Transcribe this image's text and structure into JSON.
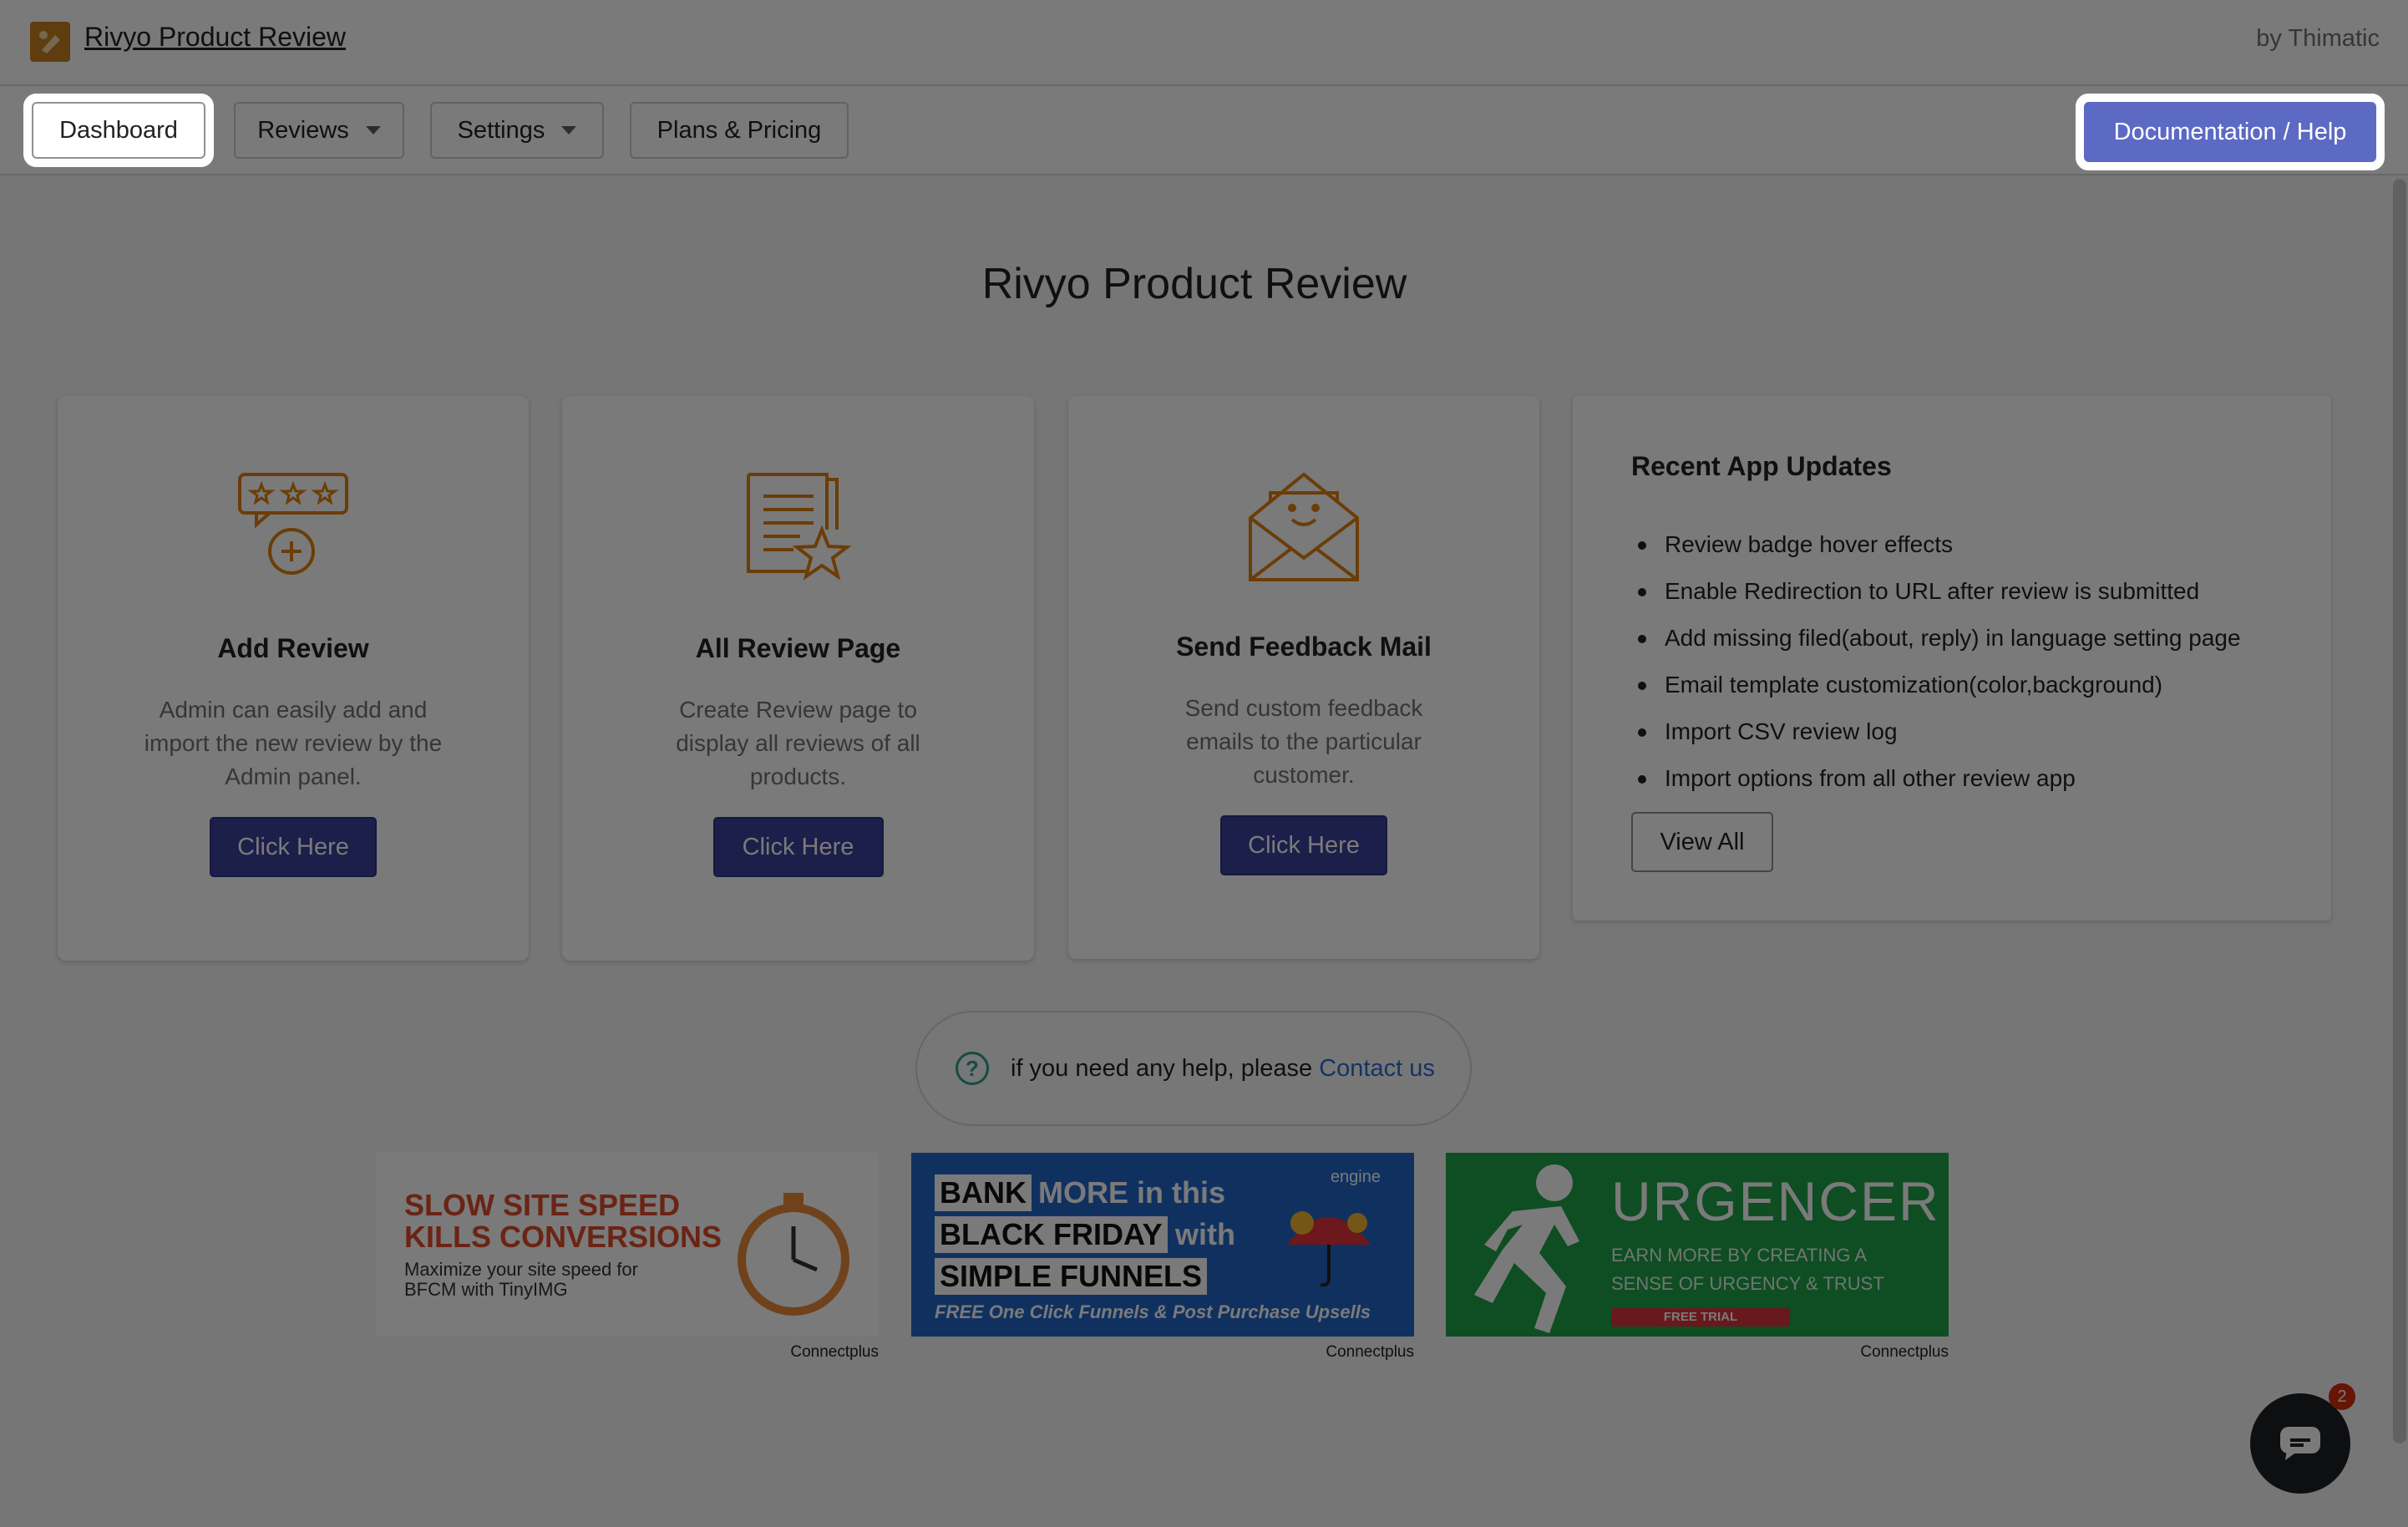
{
  "app": {
    "title": "Rivyo Product Review",
    "by": "by Thimatic",
    "logo_icon": "rivyo-logo-icon"
  },
  "nav": {
    "dashboard": "Dashboard",
    "reviews": "Reviews",
    "settings": "Settings",
    "plans": "Plans & Pricing",
    "docs": "Documentation / Help"
  },
  "main": {
    "heading": "Rivyo Product Review",
    "cards": [
      {
        "title": "Add Review",
        "desc": "Admin can easily add and import the new review by the Admin panel.",
        "button": "Click Here",
        "icon": "review-stars-plus-icon"
      },
      {
        "title": "All Review Page",
        "desc": "Create Review page to display all reviews of all products.",
        "button": "Click Here",
        "icon": "document-star-icon"
      },
      {
        "title": "Send Feedback Mail",
        "desc": "Send custom feedback emails to the particular customer.",
        "button": "Click Here",
        "icon": "smile-envelope-icon"
      }
    ],
    "updates": {
      "title": "Recent App Updates",
      "items": [
        "Review badge hover effects",
        "Enable Redirection to URL after review is submitted",
        "Add missing filed(about, reply) in language setting page",
        "Email template customization(color,background)",
        "Import CSV review log",
        "Import options from all other review app"
      ],
      "button": "View All"
    },
    "help": {
      "text": "if you need any help, please",
      "link": "Contact us",
      "icon": "question-circle-icon"
    }
  },
  "banners": [
    {
      "line1": "SLOW SITE SPEED",
      "line2": "KILLS CONVERSIONS",
      "line3": "Maximize your site speed for",
      "line4": "BFCM with TinyIMG",
      "caption": "Connectplus"
    },
    {
      "bank": "BANK",
      "more": "MORE in this",
      "bf": "BLACK FRIDAY",
      "with": "with",
      "sf": "SIMPLE FUNNELS",
      "free": "FREE One Click Funnels & Post Purchase Upsells",
      "engine": "engine",
      "caption": "Connectplus"
    },
    {
      "big": "URGENCER",
      "small1": "EARN MORE BY CREATING A",
      "small2": "SENSE OF URGENCY & TRUST",
      "trial": "FREE TRIAL",
      "caption": "Connectplus"
    }
  ],
  "chat": {
    "badge": "2",
    "icon": "chat-bubble-icon"
  },
  "colors": {
    "accent": "#5c6ac4",
    "primary_button": "#3b4299",
    "icon_orange": "#e07f12",
    "link": "#2c6ecb"
  }
}
